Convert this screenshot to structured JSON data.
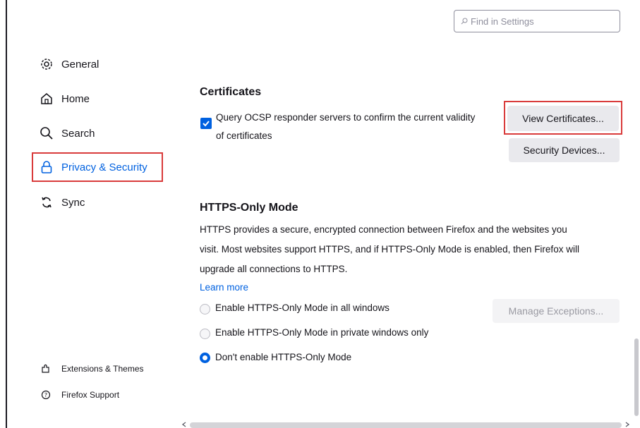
{
  "search": {
    "placeholder": "Find in Settings"
  },
  "sidebar": {
    "items": [
      {
        "label": "General",
        "icon": "gear-icon"
      },
      {
        "label": "Home",
        "icon": "home-icon"
      },
      {
        "label": "Search",
        "icon": "search-icon"
      },
      {
        "label": "Privacy & Security",
        "icon": "lock-icon",
        "selected": true
      },
      {
        "label": "Sync",
        "icon": "sync-icon"
      }
    ],
    "footer": [
      {
        "label": "Extensions & Themes",
        "icon": "puzzle-icon"
      },
      {
        "label": "Firefox Support",
        "icon": "help-icon"
      }
    ]
  },
  "certificates": {
    "heading": "Certificates",
    "ocsp_line1": "Query OCSP responder servers to confirm the current validity",
    "ocsp_line2": "of certificates",
    "ocsp_checked": true,
    "view_button": "View Certificates...",
    "devices_button": "Security Devices..."
  },
  "https_only": {
    "heading": "HTTPS-Only Mode",
    "desc_line1": "HTTPS provides a secure, encrypted connection between Firefox and the websites you",
    "desc_line2": "visit. Most websites support HTTPS, and if HTTPS-Only Mode is enabled, then Firefox will",
    "desc_line3": "upgrade all connections to HTTPS.",
    "learn_more": "Learn more",
    "options": [
      {
        "label": "Enable HTTPS-Only Mode in all windows",
        "checked": false
      },
      {
        "label": "Enable HTTPS-Only Mode in private windows only",
        "checked": false
      },
      {
        "label": "Don't enable HTTPS-Only Mode",
        "checked": true
      }
    ],
    "manage_button": "Manage Exceptions..."
  },
  "colors": {
    "accent": "#0061e0",
    "highlight": "#d93b3b"
  }
}
